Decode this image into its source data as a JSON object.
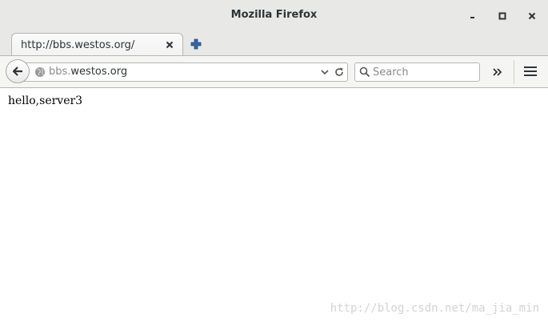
{
  "window": {
    "title": "Mozilla Firefox",
    "controls": {
      "minimize": "minimize-icon",
      "maximize": "maximize-icon",
      "close": "close-icon"
    }
  },
  "tabs": [
    {
      "title": "http://bbs.westos.org/",
      "active": true
    }
  ],
  "navbar": {
    "url": {
      "prefix": "bbs.",
      "domain": "westos.org"
    },
    "search": {
      "placeholder": "Search",
      "value": ""
    }
  },
  "page": {
    "body_text": "hello,server3"
  },
  "watermark": "http://blog.csdn.net/ma_jia_min",
  "colors": {
    "chrome_bg": "#e8e8e7",
    "toolbar_bg": "#f5f5f4",
    "border": "#b6b6b3",
    "text": "#2e3436",
    "newtab_accent": "#3465a4"
  }
}
